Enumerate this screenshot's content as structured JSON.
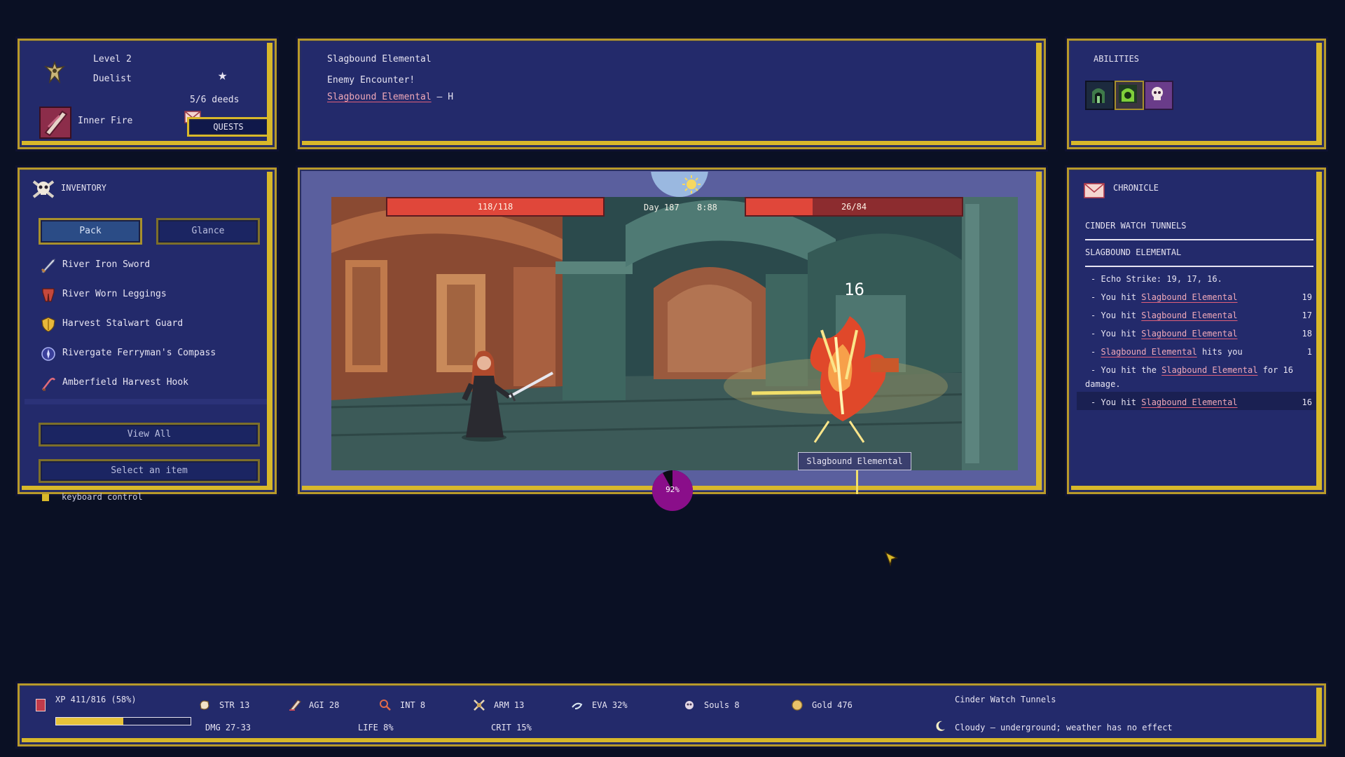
{
  "player": {
    "level": "Level 2",
    "class": "Duelist",
    "deeds": "5/6 deeds",
    "skill": "Inner Fire",
    "quests_label": "QUESTS"
  },
  "encounter": {
    "title": "Slagbound Elemental",
    "subtitle": "Enemy Encounter!",
    "enemy_link": "Slagbound Elemental",
    "enemy_suffix": "— H"
  },
  "abilities": {
    "title": "ABILITIES",
    "items": [
      {
        "icon": "tunnel-ability-icon"
      },
      {
        "icon": "green-burst-ability-icon"
      },
      {
        "icon": "skull-ability-icon"
      }
    ]
  },
  "inventory": {
    "title": "INVENTORY",
    "tabs": [
      "Pack",
      "Glance"
    ],
    "items": [
      {
        "name": "River Iron Sword",
        "icon": "sword-icon"
      },
      {
        "name": "River Worn Leggings",
        "icon": "leggings-icon"
      },
      {
        "name": "Harvest Stalwart Guard",
        "icon": "shield-icon"
      },
      {
        "name": "Rivergate Ferryman's Compass",
        "icon": "compass-icon"
      },
      {
        "name": "Amberfield Harvest Hook",
        "icon": "hook-icon"
      }
    ],
    "view_all": "View All",
    "select_item": "Select an item",
    "keyboard": "keyboard control"
  },
  "battle": {
    "player_hp": "118/118",
    "player_hp_fraction": 1.0,
    "enemy_hp": "26/84",
    "enemy_hp_fraction": 0.31,
    "day": "Day 187",
    "time": "8:88",
    "damage_popup": "16",
    "enemy_label": "Slagbound Elemental",
    "progress": "92%",
    "progress_fraction": 0.92
  },
  "chronicle": {
    "title": "CHRONICLE",
    "location": "CINDER WATCH TUNNELS",
    "enemy": "SLAGBOUND ELEMENTAL",
    "entries": [
      {
        "prefix": "- Echo Strike: 19, 17, 16.",
        "link": "",
        "suffix": "",
        "value": ""
      },
      {
        "prefix": "- You hit ",
        "link": "Slagbound Elemental",
        "suffix": "",
        "value": "19"
      },
      {
        "prefix": "- You hit ",
        "link": "Slagbound Elemental",
        "suffix": "",
        "value": "17"
      },
      {
        "prefix": "- You hit ",
        "link": "Slagbound Elemental",
        "suffix": "",
        "value": "18"
      },
      {
        "prefix": "- ",
        "link": "Slagbound Elemental",
        "suffix": " hits you",
        "value": "1"
      },
      {
        "prefix": "- You hit the ",
        "link": "Slagbound Elemental",
        "suffix": " for 16",
        "value": "",
        "cont": "damage."
      },
      {
        "prefix": "- You hit ",
        "link": "Slagbound Elemental",
        "suffix": "",
        "value": "16"
      }
    ]
  },
  "stats": {
    "xp": "XP 411/816 (58%)",
    "xp_fraction": 0.5,
    "str": "STR 13",
    "agi": "AGI 28",
    "int": "INT 8",
    "arm": "ARM 13",
    "eva": "EVA 32%",
    "souls": "Souls 8",
    "gold": "Gold 476",
    "dmg": "DMG 27-33",
    "life": "LIFE 8%",
    "crit": "CRIT 15%",
    "location": "Cinder Watch Tunnels",
    "weather": "Cloudy — underground; weather has no effect"
  },
  "colors": {
    "panel": "#232a6b",
    "gold_border": "#d8b82a",
    "hp_red": "#e0473a",
    "link_pink": "#f0a9b9",
    "progress_purple": "#8a0e8a"
  }
}
